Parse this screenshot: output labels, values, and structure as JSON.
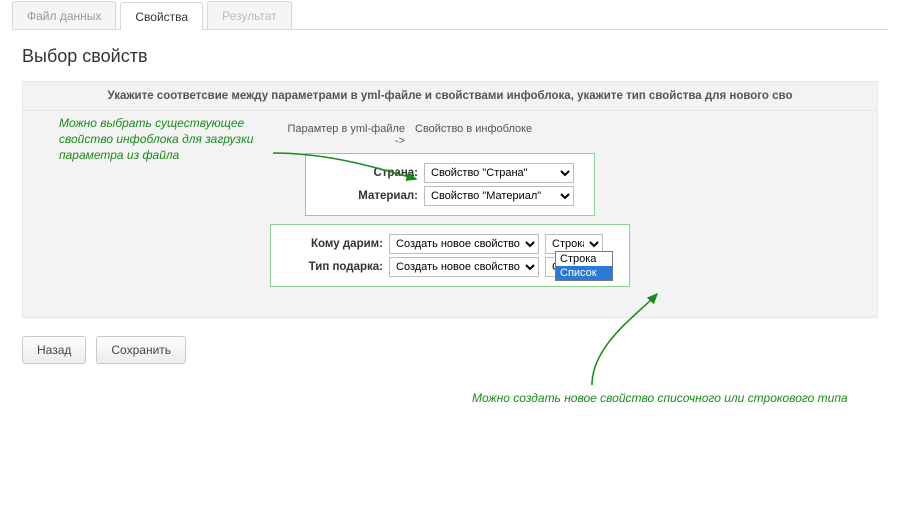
{
  "tabs": {
    "data_file": "Файл данных",
    "properties": "Свойства",
    "result": "Результат"
  },
  "title": "Выбор свойств",
  "panel_header": "Укажите соответсвие между параметрами в yml-файле и свойствами инфоблока, укажите тип свойства для нового сво",
  "columns": {
    "left": "Парамтер в yml-файле ->",
    "right": "Свойство в инфоблоке"
  },
  "group1": {
    "rows": [
      {
        "label": "Страна:",
        "value": "Свойство \"Страна\""
      },
      {
        "label": "Материал:",
        "value": "Свойство \"Материал\""
      }
    ]
  },
  "group2": {
    "rows": [
      {
        "label": "Кому дарим:",
        "value": "Создать новое свойство",
        "type": "Строка"
      },
      {
        "label": "Тип подарка:",
        "value": "Создать новое свойство",
        "type": "Строка"
      }
    ],
    "type_options": [
      "Строка",
      "Список"
    ]
  },
  "notes": {
    "left": "Можно выбрать существующее свойство инфоблока для загрузки параметра из файла",
    "bottom": "Можно создать новое свойство списочного или строкового типа"
  },
  "buttons": {
    "back": "Назад",
    "save": "Сохранить"
  }
}
